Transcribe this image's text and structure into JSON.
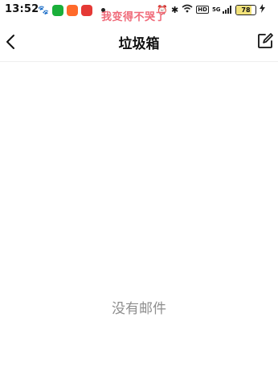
{
  "status": {
    "time": "13:52",
    "signal": "5G",
    "battery": "78",
    "battery_level": 0.78
  },
  "overlay": {
    "text": "我变得不哭了"
  },
  "header": {
    "title": "垃圾箱"
  },
  "main": {
    "empty_text": "没有邮件"
  },
  "icons": {
    "back": "chevron-left-icon",
    "compose": "edit-icon"
  }
}
